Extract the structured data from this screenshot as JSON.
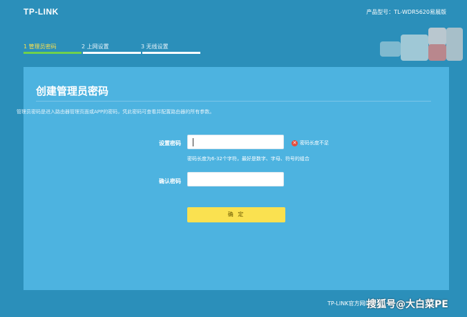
{
  "header": {
    "logo": "TP-LINK",
    "model": "产品型号：TL-WDR5620易展版"
  },
  "steps": [
    {
      "label": "1 管理员密码",
      "active": true
    },
    {
      "label": "2 上网设置",
      "active": false
    },
    {
      "label": "3 无线设置",
      "active": false
    }
  ],
  "card": {
    "title": "创建管理员密码",
    "description": "管理员密码是进入路由器管理页面或APP的密码，凭此密码可查看并配置路由器的所有参数。"
  },
  "form": {
    "password_label": "设置密码",
    "password_value": "",
    "error_text": "密码长度不足",
    "hint": "密码长度为6-32个字符，最好是数字、字母、符号的组合",
    "confirm_label": "确认密码",
    "confirm_value": "",
    "submit_label": "确 定"
  },
  "footer": {
    "link": "TP-LINK官方网站"
  },
  "watermark": "搜狐号@大白菜PE",
  "colors": {
    "background": "#2b8fba",
    "card": "#4db3e0",
    "accent_yellow": "#fae150",
    "step_active": "#6fd14c",
    "error": "#e74c3c"
  }
}
